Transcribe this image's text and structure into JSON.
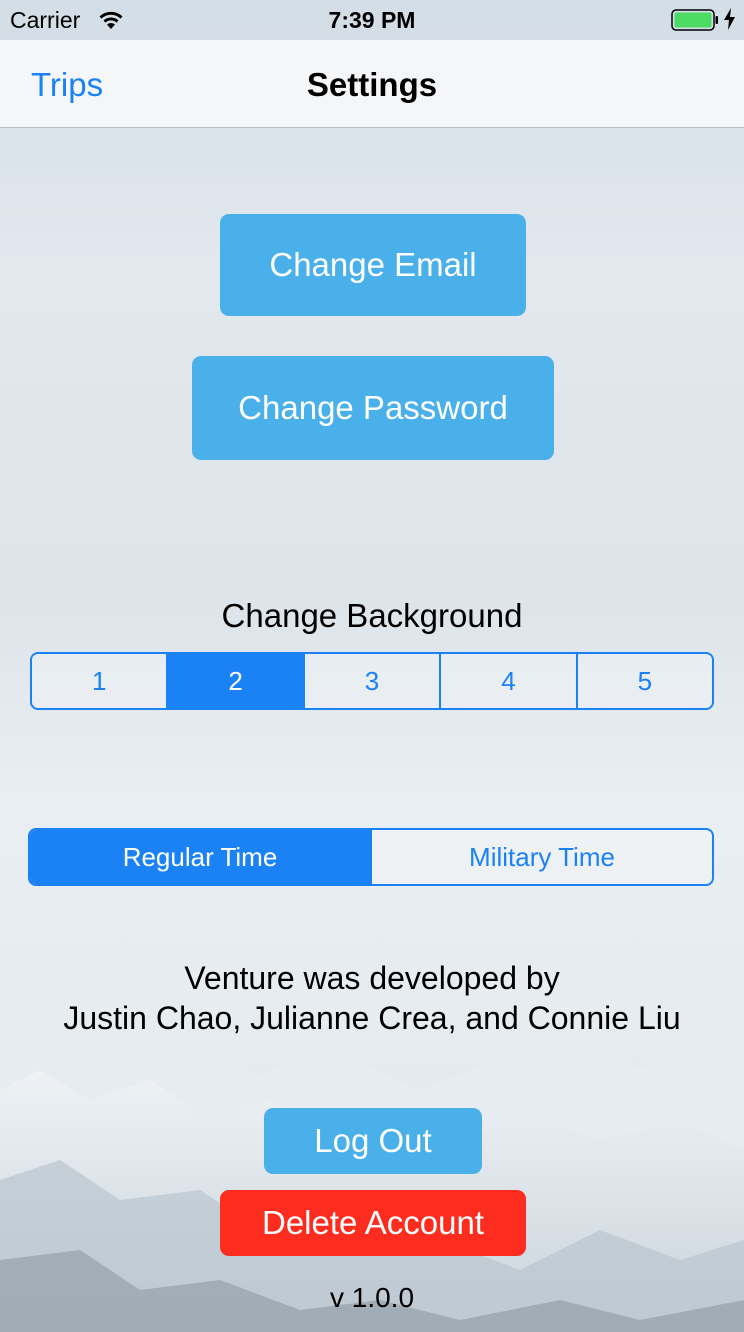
{
  "status_bar": {
    "carrier": "Carrier",
    "time": "7:39 PM"
  },
  "nav": {
    "back_label": "Trips",
    "title": "Settings"
  },
  "account": {
    "change_email": "Change Email",
    "change_password": "Change Password"
  },
  "background": {
    "label": "Change Background",
    "options": [
      "1",
      "2",
      "3",
      "4",
      "5"
    ],
    "selected": "2"
  },
  "time_format": {
    "options": [
      "Regular Time",
      "Military Time"
    ],
    "selected": "Regular Time"
  },
  "credits": {
    "line1": "Venture was developed by",
    "line2": "Justin Chao, Julianne Crea, and Connie Liu"
  },
  "actions": {
    "log_out": "Log Out",
    "delete_account": "Delete Account"
  },
  "version": "v 1.0.0",
  "colors": {
    "tint": "#1a82f5",
    "button_blue": "#4ab0ea",
    "button_red": "#fc2c1f",
    "battery_green": "#4cd964"
  },
  "icons": {
    "wifi": "wifi-icon",
    "battery": "battery-icon",
    "charging": "charging-bolt-icon"
  }
}
